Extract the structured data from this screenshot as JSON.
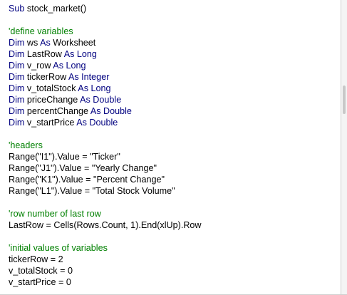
{
  "editor": {
    "lines": [
      {
        "segments": [
          {
            "k": "kw",
            "t": "Sub"
          },
          {
            "k": "tx",
            "t": " stock_market()"
          }
        ]
      },
      {
        "segments": []
      },
      {
        "segments": [
          {
            "k": "cm",
            "t": "'define variables"
          }
        ]
      },
      {
        "segments": [
          {
            "k": "kw",
            "t": "Dim"
          },
          {
            "k": "tx",
            "t": " ws "
          },
          {
            "k": "kw",
            "t": "As"
          },
          {
            "k": "tx",
            "t": " Worksheet"
          }
        ]
      },
      {
        "segments": [
          {
            "k": "kw",
            "t": "Dim"
          },
          {
            "k": "tx",
            "t": " LastRow "
          },
          {
            "k": "kw",
            "t": "As Long"
          }
        ]
      },
      {
        "segments": [
          {
            "k": "kw",
            "t": "Dim"
          },
          {
            "k": "tx",
            "t": " v_row "
          },
          {
            "k": "kw",
            "t": "As Long"
          }
        ]
      },
      {
        "segments": [
          {
            "k": "kw",
            "t": "Dim"
          },
          {
            "k": "tx",
            "t": " tickerRow "
          },
          {
            "k": "kw",
            "t": "As Integer"
          }
        ]
      },
      {
        "segments": [
          {
            "k": "kw",
            "t": "Dim"
          },
          {
            "k": "tx",
            "t": " v_totalStock "
          },
          {
            "k": "kw",
            "t": "As Long"
          }
        ]
      },
      {
        "segments": [
          {
            "k": "kw",
            "t": "Dim"
          },
          {
            "k": "tx",
            "t": " priceChange "
          },
          {
            "k": "kw",
            "t": "As Double"
          }
        ]
      },
      {
        "segments": [
          {
            "k": "kw",
            "t": "Dim"
          },
          {
            "k": "tx",
            "t": " percentChange "
          },
          {
            "k": "kw",
            "t": "As Double"
          }
        ]
      },
      {
        "segments": [
          {
            "k": "kw",
            "t": "Dim"
          },
          {
            "k": "tx",
            "t": " v_startPrice "
          },
          {
            "k": "kw",
            "t": "As Double"
          }
        ]
      },
      {
        "segments": []
      },
      {
        "segments": [
          {
            "k": "cm",
            "t": "'headers"
          }
        ]
      },
      {
        "segments": [
          {
            "k": "tx",
            "t": "Range(\"I1\").Value = \"Ticker\""
          }
        ]
      },
      {
        "segments": [
          {
            "k": "tx",
            "t": "Range(\"J1\").Value = \"Yearly Change\""
          }
        ]
      },
      {
        "segments": [
          {
            "k": "tx",
            "t": "Range(\"K1\").Value = \"Percent Change\""
          }
        ]
      },
      {
        "segments": [
          {
            "k": "tx",
            "t": "Range(\"L1\").Value = \"Total Stock Volume\""
          }
        ]
      },
      {
        "segments": []
      },
      {
        "segments": [
          {
            "k": "cm",
            "t": "'row number of last row"
          }
        ]
      },
      {
        "segments": [
          {
            "k": "tx",
            "t": "LastRow = Cells(Rows.Count, 1).End(xlUp).Row"
          }
        ]
      },
      {
        "segments": []
      },
      {
        "segments": [
          {
            "k": "cm",
            "t": "'initial values of variables"
          }
        ]
      },
      {
        "segments": [
          {
            "k": "tx",
            "t": "tickerRow = 2"
          }
        ]
      },
      {
        "segments": [
          {
            "k": "tx",
            "t": "v_totalStock = 0"
          }
        ]
      },
      {
        "segments": [
          {
            "k": "tx",
            "t": "v_startPrice = 0"
          }
        ]
      }
    ]
  },
  "colors": {
    "keyword": "#000080",
    "comment": "#008000",
    "text": "#000000",
    "background": "#ffffff"
  }
}
